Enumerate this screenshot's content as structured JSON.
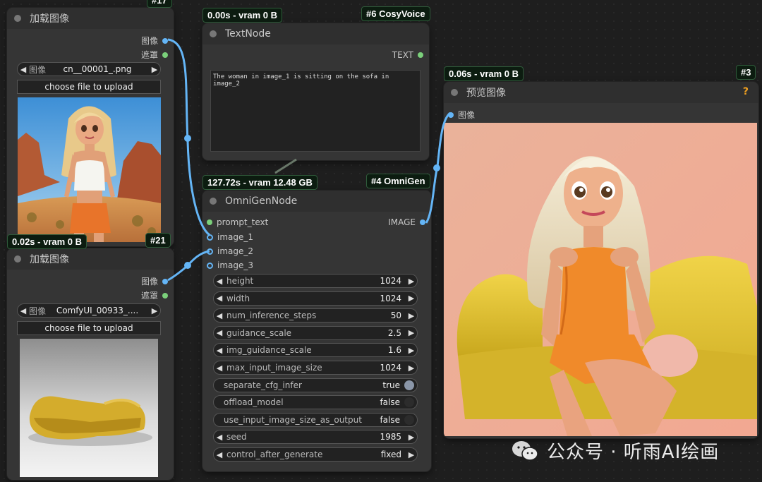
{
  "nodes": {
    "load1": {
      "title": "加载图像",
      "badge_top": "#17",
      "output_image": "图像",
      "output_mask": "遮罩",
      "combo_label": "图像",
      "combo_value": "cn__00001_.png",
      "upload_label": "choose file to upload",
      "exec_badge": "0.02s - vram 0 B",
      "id_badge": "#21"
    },
    "load2": {
      "title": "加载图像",
      "output_image": "图像",
      "output_mask": "遮罩",
      "combo_label": "图像",
      "combo_value": "ComfyUI_00933_....",
      "upload_label": "choose file to upload"
    },
    "text": {
      "title": "TextNode",
      "exec_badge": "0.00s - vram 0 B",
      "id_badge": "#6 CosyVoice",
      "output": "TEXT",
      "value": "The woman in image_1 is sitting on the sofa in image_2"
    },
    "omni": {
      "title": "OmniGenNode",
      "exec_badge": "127.72s - vram 12.48 GB",
      "id_badge": "#4 OmniGen",
      "inputs": [
        "prompt_text",
        "image_1",
        "image_2",
        "image_3"
      ],
      "output": "IMAGE",
      "widgets": [
        {
          "name": "height",
          "value": "1024",
          "kind": "number"
        },
        {
          "name": "width",
          "value": "1024",
          "kind": "number"
        },
        {
          "name": "num_inference_steps",
          "value": "50",
          "kind": "number"
        },
        {
          "name": "guidance_scale",
          "value": "2.5",
          "kind": "number"
        },
        {
          "name": "img_guidance_scale",
          "value": "1.6",
          "kind": "number"
        },
        {
          "name": "max_input_image_size",
          "value": "1024",
          "kind": "number"
        },
        {
          "name": "separate_cfg_infer",
          "value": "true",
          "kind": "toggle"
        },
        {
          "name": "offload_model",
          "value": "false",
          "kind": "toggle"
        },
        {
          "name": "use_input_image_size_as_output",
          "value": "false",
          "kind": "toggle"
        },
        {
          "name": "seed",
          "value": "1985",
          "kind": "number"
        },
        {
          "name": "control_after_generate",
          "value": "fixed",
          "kind": "number"
        }
      ]
    },
    "preview": {
      "title": "预览图像",
      "exec_badge": "0.06s - vram 0 B",
      "id_badge": "#3",
      "help": "?",
      "input": "图像"
    }
  },
  "watermark": "公众号 · 听雨AI绘画",
  "colors": {
    "wire_image": "#64b5f6",
    "wire_text": "#7bd07b",
    "badge_bg": "#0c1c10",
    "help": "#f0a020"
  }
}
